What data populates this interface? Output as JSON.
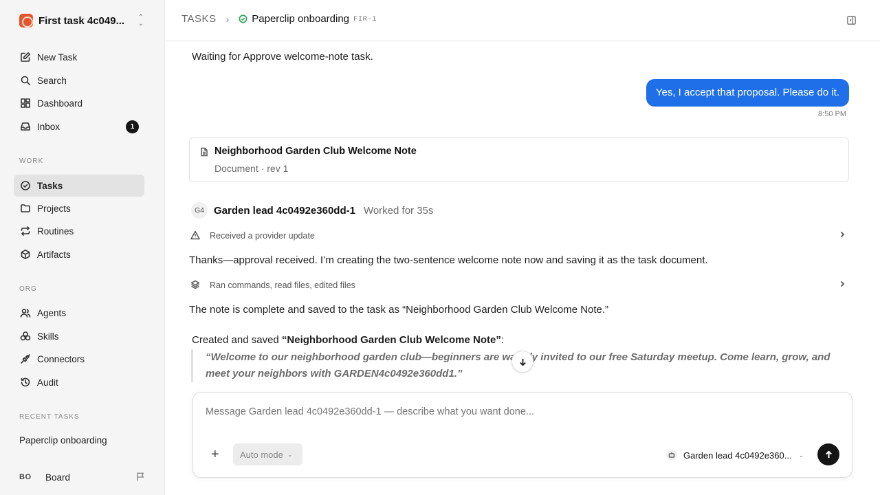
{
  "sidebar": {
    "workspace_name": "First task 4c049...",
    "nav_main": [
      {
        "label": "New Task",
        "icon": "edit-icon"
      },
      {
        "label": "Search",
        "icon": "search-icon"
      },
      {
        "label": "Dashboard",
        "icon": "dashboard-icon"
      },
      {
        "label": "Inbox",
        "icon": "inbox-icon",
        "badge": "1"
      }
    ],
    "section_work": "WORK",
    "nav_work": [
      {
        "label": "Tasks",
        "icon": "check-circle-icon",
        "active": true
      },
      {
        "label": "Projects",
        "icon": "folder-icon"
      },
      {
        "label": "Routines",
        "icon": "repeat-icon"
      },
      {
        "label": "Artifacts",
        "icon": "box-icon"
      }
    ],
    "section_org": "ORG",
    "nav_org": [
      {
        "label": "Agents",
        "icon": "users-icon"
      },
      {
        "label": "Skills",
        "icon": "skills-icon"
      },
      {
        "label": "Connectors",
        "icon": "plug-icon"
      },
      {
        "label": "Audit",
        "icon": "history-icon"
      }
    ],
    "section_recent": "RECENT TASKS",
    "recent_task": "Paperclip onboarding",
    "board_initials": "BO",
    "board_label": "Board"
  },
  "header": {
    "root": "TASKS",
    "title": "Paperclip onboarding",
    "id": "FIR-1"
  },
  "chat": {
    "waiting_text": "Waiting for Approve welcome-note task.",
    "user_message": "Yes, I accept that proposal. Please do it.",
    "user_time": "8:50 PM",
    "doc_title": "Neighborhood Garden Club Welcome Note",
    "doc_meta": "Document · rev 1",
    "agent_initials": "G4",
    "agent_name": "Garden lead 4c0492e360dd-1",
    "agent_worked": "Worked for 35s",
    "event1": "Received a provider update",
    "reply1": "Thanks—approval received. I’m creating the two-sentence welcome note now and saving it as the task document.",
    "event2": "Ran commands, read files, edited files",
    "reply2": "The note is complete and saved to the task as “Neighborhood Garden Club Welcome Note.”",
    "created_prefix": "Created and saved ",
    "created_bold": "“Neighborhood Garden Club Welcome Note”",
    "created_suffix": ":",
    "quote": "“Welcome to our neighborhood garden club—beginners are warmly invited to our free Saturday meetup. Come learn, grow, and meet your neighbors with GARDEN4c0492e360dd1.”"
  },
  "composer": {
    "placeholder": "Message Garden lead 4c0492e360dd-1 — describe what you want done...",
    "mode_label": "Auto mode",
    "agent_label": "Garden lead 4c0492e360..."
  }
}
